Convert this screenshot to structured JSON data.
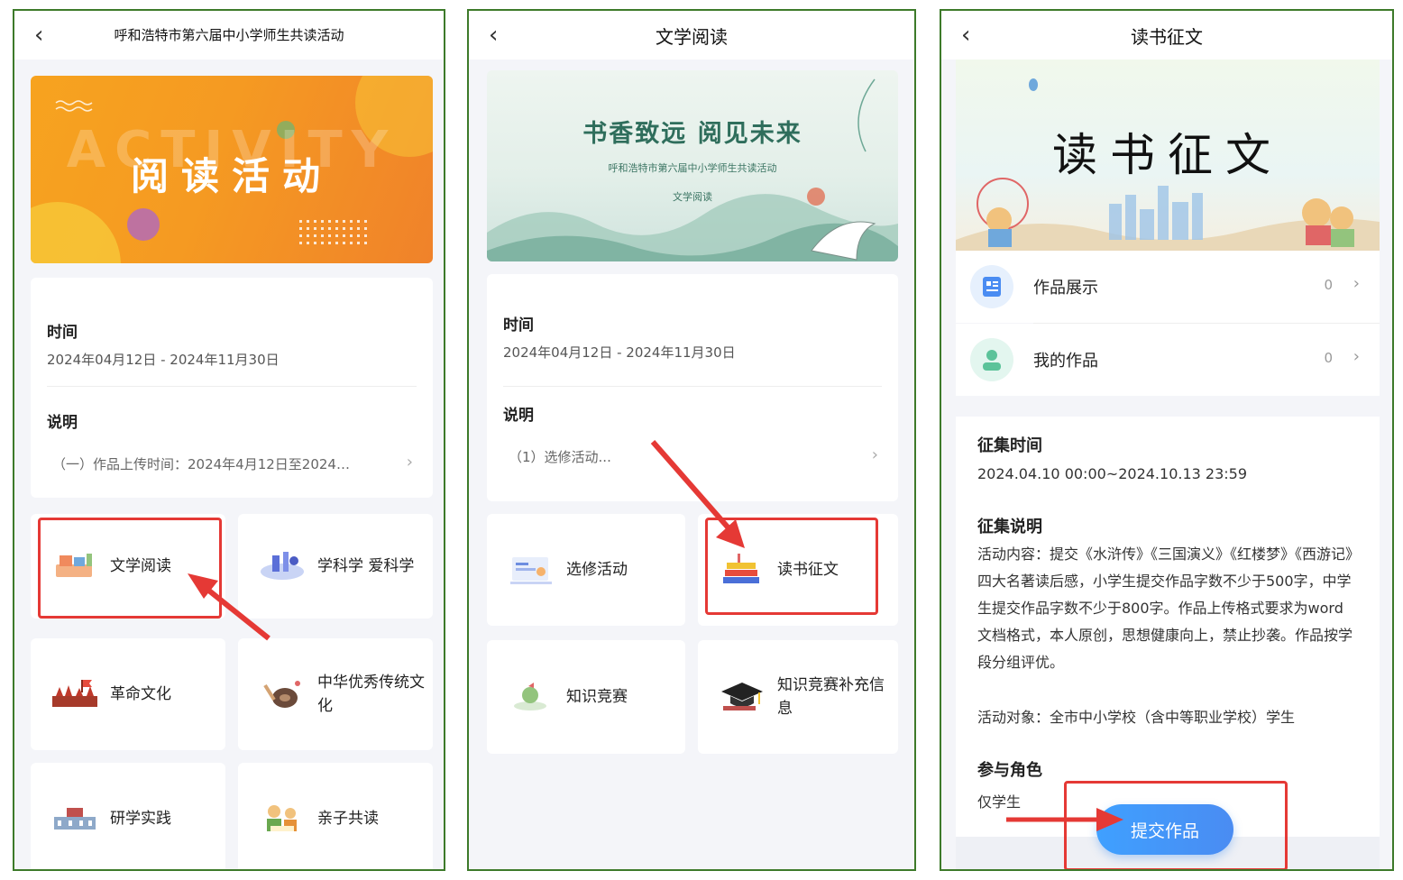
{
  "panel1": {
    "back_icon": "chevron-left",
    "title": "呼和浩特市第六届中小学师生共读活动",
    "banner_text": "阅读活动",
    "banner_ghost": "ACTIVITY",
    "time_label": "时间",
    "time_value": "2024年04月12日 - 2024年11月30日",
    "desc_label": "说明",
    "desc_value": "（一）作品上传时间：2024年4月12日至2024…",
    "tiles": [
      {
        "label": "文学阅读",
        "icon": "books-icon"
      },
      {
        "label": "学科学 爱科学",
        "icon": "science-icon"
      },
      {
        "label": "革命文化",
        "icon": "revolution-icon"
      },
      {
        "label": "中华优秀传统文化",
        "icon": "tradition-icon"
      },
      {
        "label": "研学实践",
        "icon": "school-icon"
      },
      {
        "label": "亲子共读",
        "icon": "family-icon"
      }
    ],
    "highlight_color": "#e53935"
  },
  "panel2": {
    "title": "文学阅读",
    "banner_title": "书香致远 阅见未来",
    "banner_subtitle": "呼和浩特市第六届中小学师生共读活动",
    "banner_tag": "文学阅读",
    "time_label": "时间",
    "time_value": "2024年04月12日 - 2024年11月30日",
    "desc_label": "说明",
    "desc_value": "（1）选修活动...",
    "tiles": [
      {
        "label": "选修活动",
        "icon": "elective-icon"
      },
      {
        "label": "读书征文",
        "icon": "book-stack-icon"
      },
      {
        "label": "知识竞赛",
        "icon": "quiz-icon"
      },
      {
        "label": "知识竞赛补充信息",
        "icon": "graduation-cap-icon"
      }
    ]
  },
  "panel3": {
    "title": "读书征文",
    "banner_title": "读书征文",
    "rows": [
      {
        "label": "作品展示",
        "count": "0",
        "icon": "document-icon"
      },
      {
        "label": "我的作品",
        "count": "0",
        "icon": "user-icon"
      }
    ],
    "collect_time_label": "征集时间",
    "collect_time_value": "2024.04.10 00:00~2024.10.13 23:59",
    "collect_desc_label": "征集说明",
    "collect_desc_text": "活动内容：提交《水浒传》《三国演义》《红楼梦》《西游记》四大名著读后感，小学生提交作品字数不少于500字，中学生提交作品字数不少于800字。作品上传格式要求为word文档格式，本人原创，思想健康向上，禁止抄袭。作品按学段分组评优。",
    "collect_target": "活动对象：全市中小学校（含中等职业学校）学生",
    "role_label": "参与角色",
    "role_value": "仅学生",
    "submit_label": "提交作品",
    "accent": "#4a8cf2"
  }
}
